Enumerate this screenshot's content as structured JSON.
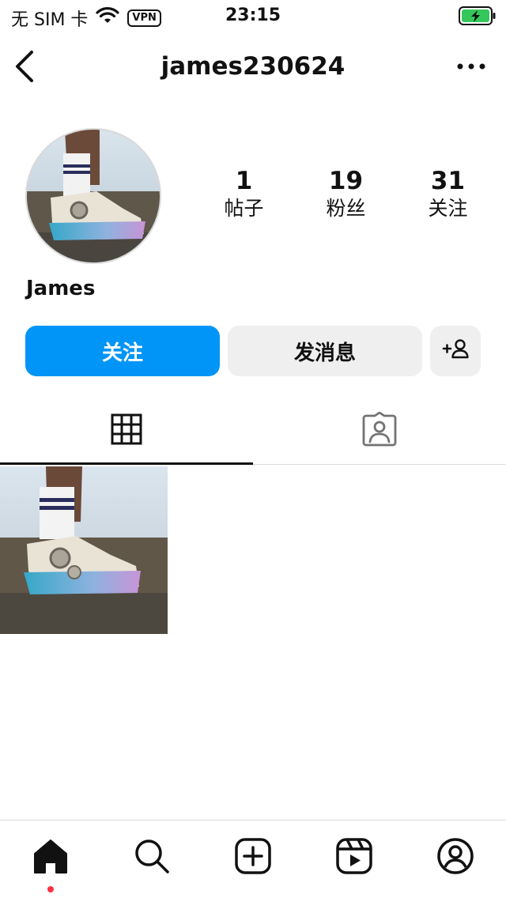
{
  "status_bar": {
    "carrier": "无 SIM 卡",
    "vpn": "VPN",
    "time": "23:15"
  },
  "header": {
    "username": "james230624"
  },
  "profile": {
    "display_name": "James",
    "stats": [
      {
        "count": "1",
        "label": "帖子"
      },
      {
        "count": "19",
        "label": "粉丝"
      },
      {
        "count": "31",
        "label": "关注"
      }
    ]
  },
  "actions": {
    "follow_label": "关注",
    "message_label": "发消息"
  },
  "colors": {
    "accent": "#0095f6",
    "secondary_button": "#efefef",
    "notification_dot": "#ff3040",
    "battery_charging": "#34c759"
  },
  "icons": {
    "back": "chevron-left-icon",
    "more": "more-horizontal-icon",
    "suggest": "add-person-icon",
    "grid_tab": "grid-icon",
    "tagged_tab": "tagged-person-icon",
    "tabbar": [
      "home-icon",
      "search-icon",
      "create-icon",
      "reels-icon",
      "profile-icon"
    ]
  }
}
